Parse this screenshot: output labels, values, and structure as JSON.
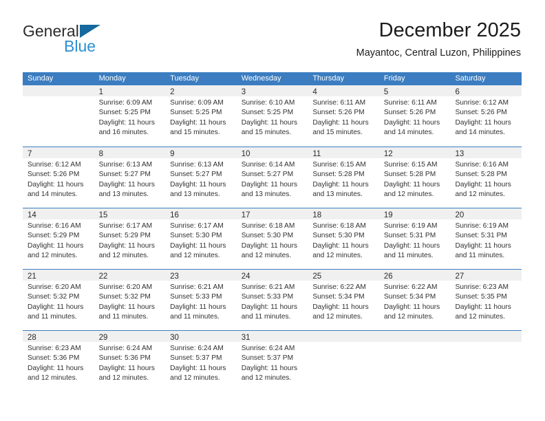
{
  "brand": {
    "name_part1": "General",
    "name_part2": "Blue",
    "flag_icon": "blue-triangle-flag-icon",
    "accent_color": "#2b8fd4",
    "header_color": "#3b7dc0"
  },
  "header": {
    "title": "December 2025",
    "subtitle": "Mayantoc, Central Luzon, Philippines"
  },
  "calendar": {
    "weekday_headers": [
      "Sunday",
      "Monday",
      "Tuesday",
      "Wednesday",
      "Thursday",
      "Friday",
      "Saturday"
    ],
    "weeks": [
      [
        {
          "day": "",
          "sunrise": "",
          "sunset": "",
          "daylight": "",
          "empty": true
        },
        {
          "day": "1",
          "sunrise": "Sunrise: 6:09 AM",
          "sunset": "Sunset: 5:25 PM",
          "daylight": "Daylight: 11 hours and 16 minutes."
        },
        {
          "day": "2",
          "sunrise": "Sunrise: 6:09 AM",
          "sunset": "Sunset: 5:25 PM",
          "daylight": "Daylight: 11 hours and 15 minutes."
        },
        {
          "day": "3",
          "sunrise": "Sunrise: 6:10 AM",
          "sunset": "Sunset: 5:25 PM",
          "daylight": "Daylight: 11 hours and 15 minutes."
        },
        {
          "day": "4",
          "sunrise": "Sunrise: 6:11 AM",
          "sunset": "Sunset: 5:26 PM",
          "daylight": "Daylight: 11 hours and 15 minutes."
        },
        {
          "day": "5",
          "sunrise": "Sunrise: 6:11 AM",
          "sunset": "Sunset: 5:26 PM",
          "daylight": "Daylight: 11 hours and 14 minutes."
        },
        {
          "day": "6",
          "sunrise": "Sunrise: 6:12 AM",
          "sunset": "Sunset: 5:26 PM",
          "daylight": "Daylight: 11 hours and 14 minutes."
        }
      ],
      [
        {
          "day": "7",
          "sunrise": "Sunrise: 6:12 AM",
          "sunset": "Sunset: 5:26 PM",
          "daylight": "Daylight: 11 hours and 14 minutes."
        },
        {
          "day": "8",
          "sunrise": "Sunrise: 6:13 AM",
          "sunset": "Sunset: 5:27 PM",
          "daylight": "Daylight: 11 hours and 13 minutes."
        },
        {
          "day": "9",
          "sunrise": "Sunrise: 6:13 AM",
          "sunset": "Sunset: 5:27 PM",
          "daylight": "Daylight: 11 hours and 13 minutes."
        },
        {
          "day": "10",
          "sunrise": "Sunrise: 6:14 AM",
          "sunset": "Sunset: 5:27 PM",
          "daylight": "Daylight: 11 hours and 13 minutes."
        },
        {
          "day": "11",
          "sunrise": "Sunrise: 6:15 AM",
          "sunset": "Sunset: 5:28 PM",
          "daylight": "Daylight: 11 hours and 13 minutes."
        },
        {
          "day": "12",
          "sunrise": "Sunrise: 6:15 AM",
          "sunset": "Sunset: 5:28 PM",
          "daylight": "Daylight: 11 hours and 12 minutes."
        },
        {
          "day": "13",
          "sunrise": "Sunrise: 6:16 AM",
          "sunset": "Sunset: 5:28 PM",
          "daylight": "Daylight: 11 hours and 12 minutes."
        }
      ],
      [
        {
          "day": "14",
          "sunrise": "Sunrise: 6:16 AM",
          "sunset": "Sunset: 5:29 PM",
          "daylight": "Daylight: 11 hours and 12 minutes."
        },
        {
          "day": "15",
          "sunrise": "Sunrise: 6:17 AM",
          "sunset": "Sunset: 5:29 PM",
          "daylight": "Daylight: 11 hours and 12 minutes."
        },
        {
          "day": "16",
          "sunrise": "Sunrise: 6:17 AM",
          "sunset": "Sunset: 5:30 PM",
          "daylight": "Daylight: 11 hours and 12 minutes."
        },
        {
          "day": "17",
          "sunrise": "Sunrise: 6:18 AM",
          "sunset": "Sunset: 5:30 PM",
          "daylight": "Daylight: 11 hours and 12 minutes."
        },
        {
          "day": "18",
          "sunrise": "Sunrise: 6:18 AM",
          "sunset": "Sunset: 5:30 PM",
          "daylight": "Daylight: 11 hours and 12 minutes."
        },
        {
          "day": "19",
          "sunrise": "Sunrise: 6:19 AM",
          "sunset": "Sunset: 5:31 PM",
          "daylight": "Daylight: 11 hours and 11 minutes."
        },
        {
          "day": "20",
          "sunrise": "Sunrise: 6:19 AM",
          "sunset": "Sunset: 5:31 PM",
          "daylight": "Daylight: 11 hours and 11 minutes."
        }
      ],
      [
        {
          "day": "21",
          "sunrise": "Sunrise: 6:20 AM",
          "sunset": "Sunset: 5:32 PM",
          "daylight": "Daylight: 11 hours and 11 minutes."
        },
        {
          "day": "22",
          "sunrise": "Sunrise: 6:20 AM",
          "sunset": "Sunset: 5:32 PM",
          "daylight": "Daylight: 11 hours and 11 minutes."
        },
        {
          "day": "23",
          "sunrise": "Sunrise: 6:21 AM",
          "sunset": "Sunset: 5:33 PM",
          "daylight": "Daylight: 11 hours and 11 minutes."
        },
        {
          "day": "24",
          "sunrise": "Sunrise: 6:21 AM",
          "sunset": "Sunset: 5:33 PM",
          "daylight": "Daylight: 11 hours and 11 minutes."
        },
        {
          "day": "25",
          "sunrise": "Sunrise: 6:22 AM",
          "sunset": "Sunset: 5:34 PM",
          "daylight": "Daylight: 11 hours and 12 minutes."
        },
        {
          "day": "26",
          "sunrise": "Sunrise: 6:22 AM",
          "sunset": "Sunset: 5:34 PM",
          "daylight": "Daylight: 11 hours and 12 minutes."
        },
        {
          "day": "27",
          "sunrise": "Sunrise: 6:23 AM",
          "sunset": "Sunset: 5:35 PM",
          "daylight": "Daylight: 11 hours and 12 minutes."
        }
      ],
      [
        {
          "day": "28",
          "sunrise": "Sunrise: 6:23 AM",
          "sunset": "Sunset: 5:36 PM",
          "daylight": "Daylight: 11 hours and 12 minutes."
        },
        {
          "day": "29",
          "sunrise": "Sunrise: 6:24 AM",
          "sunset": "Sunset: 5:36 PM",
          "daylight": "Daylight: 11 hours and 12 minutes."
        },
        {
          "day": "30",
          "sunrise": "Sunrise: 6:24 AM",
          "sunset": "Sunset: 5:37 PM",
          "daylight": "Daylight: 11 hours and 12 minutes."
        },
        {
          "day": "31",
          "sunrise": "Sunrise: 6:24 AM",
          "sunset": "Sunset: 5:37 PM",
          "daylight": "Daylight: 11 hours and 12 minutes."
        },
        {
          "day": "",
          "sunrise": "",
          "sunset": "",
          "daylight": "",
          "empty": true
        },
        {
          "day": "",
          "sunrise": "",
          "sunset": "",
          "daylight": "",
          "empty": true
        },
        {
          "day": "",
          "sunrise": "",
          "sunset": "",
          "daylight": "",
          "empty": true
        }
      ]
    ]
  }
}
